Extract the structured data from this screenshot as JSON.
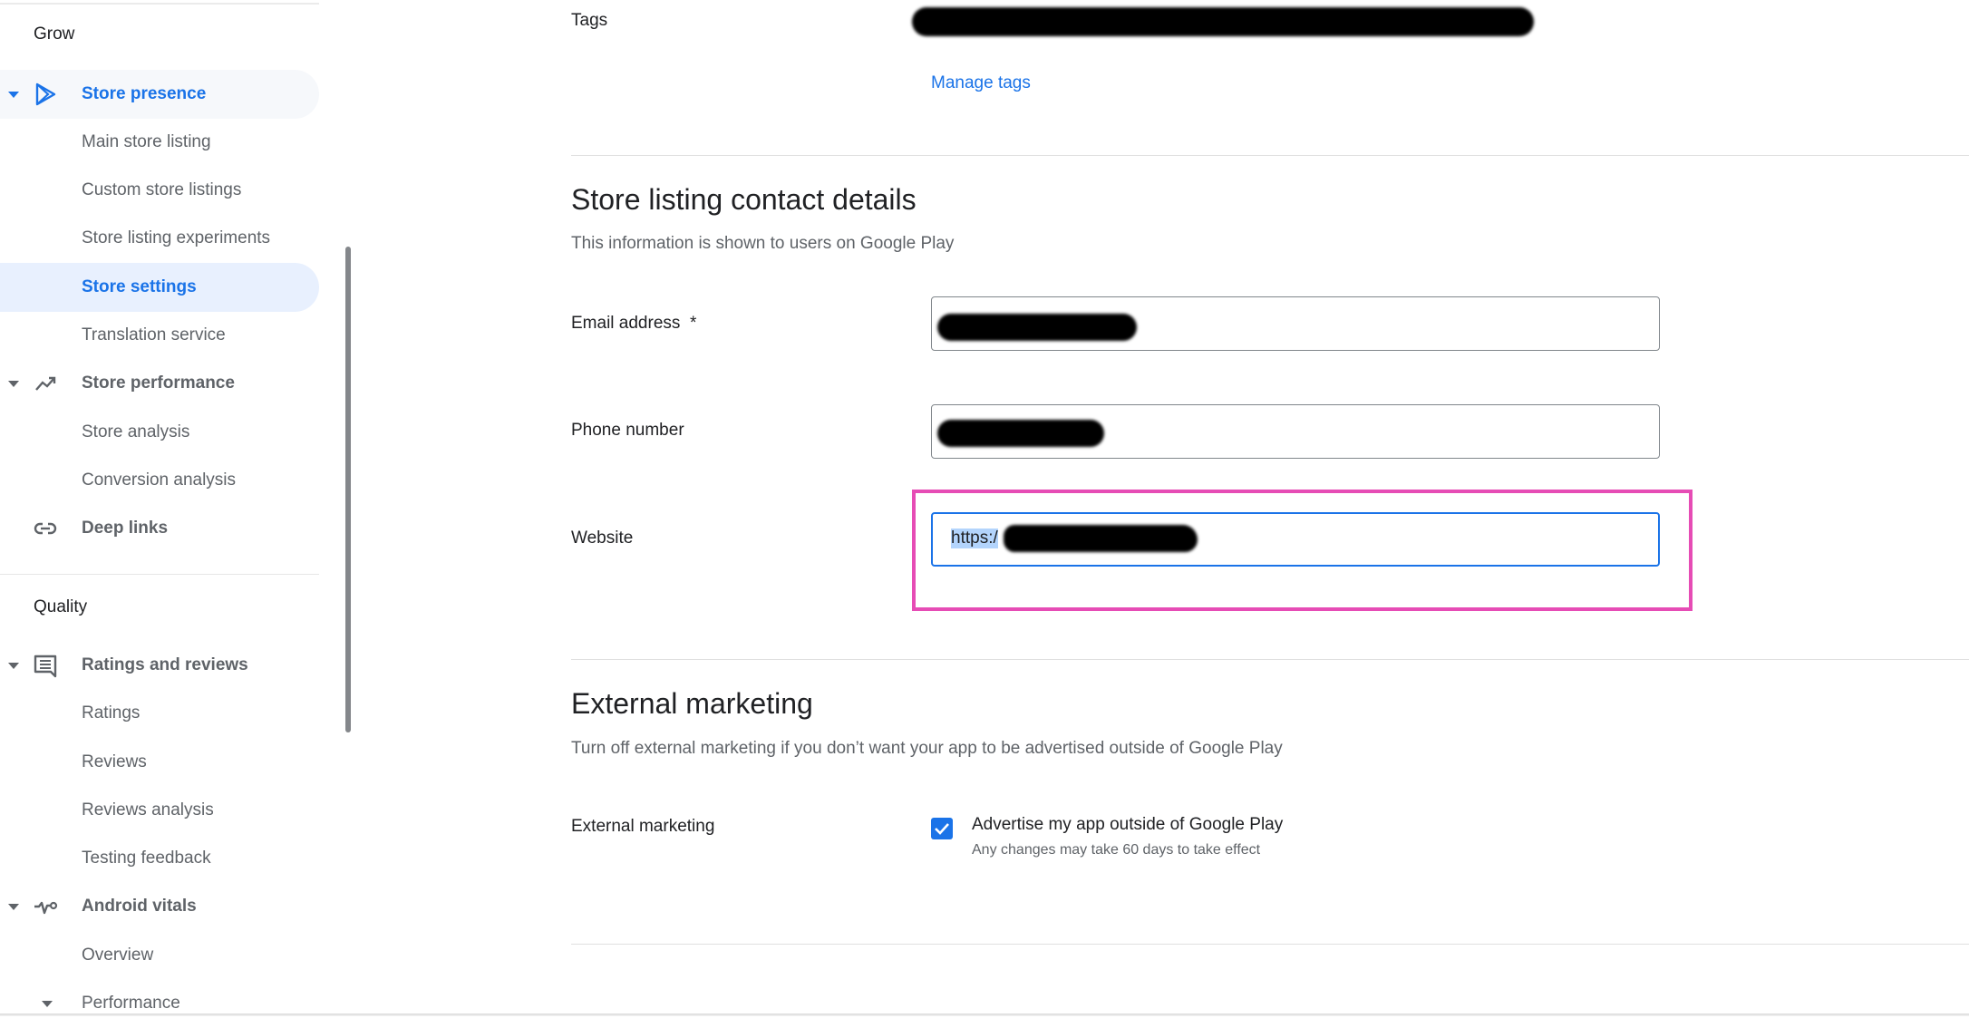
{
  "sidebar": {
    "sections": [
      {
        "title": "Grow"
      },
      {
        "title": "Quality"
      }
    ],
    "items": [
      {
        "label": "Store presence",
        "icon": "play-store-icon",
        "expanded": true,
        "state": "active-parent"
      },
      {
        "label": "Main store listing"
      },
      {
        "label": "Custom store listings"
      },
      {
        "label": "Store listing experiments"
      },
      {
        "label": "Store settings",
        "state": "selected"
      },
      {
        "label": "Translation service"
      },
      {
        "label": "Store performance",
        "icon": "trending-up-icon",
        "expanded": true
      },
      {
        "label": "Store analysis"
      },
      {
        "label": "Conversion analysis"
      },
      {
        "label": "Deep links",
        "icon": "link-icon"
      },
      {
        "label": "Ratings and reviews",
        "icon": "reviews-icon",
        "expanded": true
      },
      {
        "label": "Ratings"
      },
      {
        "label": "Reviews"
      },
      {
        "label": "Reviews analysis"
      },
      {
        "label": "Testing feedback"
      },
      {
        "label": "Android vitals",
        "icon": "vitals-icon",
        "expanded": true
      },
      {
        "label": "Overview"
      },
      {
        "label": "Performance",
        "expanded": true
      }
    ]
  },
  "main": {
    "tags": {
      "label": "Tags",
      "value": "[redacted]",
      "manage_link": "Manage tags"
    },
    "contact": {
      "heading": "Store listing contact details",
      "subtitle": "This information is shown to users on Google Play",
      "email": {
        "label": "Email address",
        "required_mark": "*",
        "value": "[redacted]"
      },
      "phone": {
        "label": "Phone number",
        "value": "[redacted]"
      },
      "website": {
        "label": "Website",
        "value_visible": "https:/",
        "value": "[redacted]",
        "focused": true,
        "highlighted": true
      }
    },
    "external_marketing": {
      "heading": "External marketing",
      "subtitle": "Turn off external marketing if you don’t want your app to be advertised outside of Google Play",
      "label": "External marketing",
      "checkbox_label": "Advertise my app outside of Google Play",
      "checkbox_checked": true,
      "helper": "Any changes may take 60 days to take effect"
    }
  },
  "colors": {
    "accent": "#1a73e8",
    "highlight_box": "#e64cb5",
    "selected_nav_bg": "#e8f0fe",
    "text_secondary": "#5f6368"
  }
}
